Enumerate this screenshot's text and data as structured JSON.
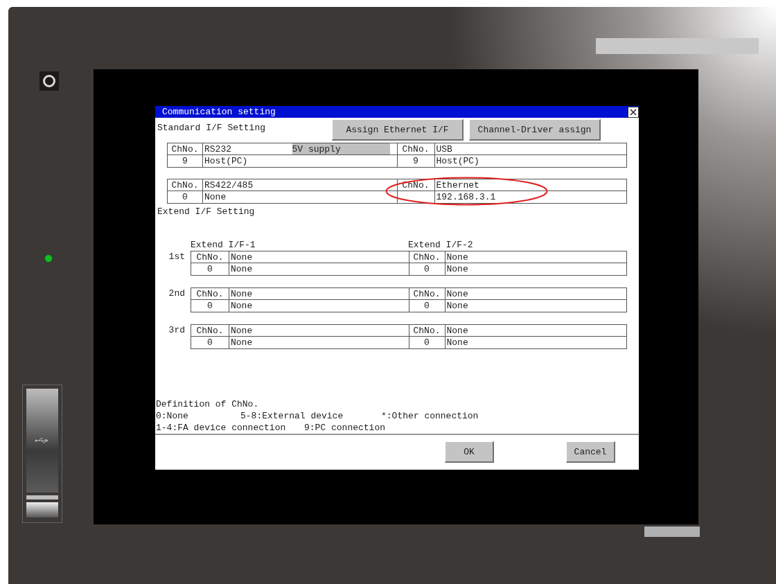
{
  "dialog": {
    "title": "Communication setting",
    "standard": {
      "label": "Standard I/F Setting",
      "buttons": [
        "Assign Ethernet I/F",
        "Channel-Driver assign"
      ],
      "rows": [
        {
          "ports": [
            {
              "ch_header": "ChNo.",
              "name": "RS232",
              "badge": "5V supply",
              "channel": "9",
              "value": "Host(PC)",
              "highlighted": false
            },
            {
              "ch_header": "ChNo.",
              "name": "USB",
              "channel": "9",
              "value": "Host(PC)",
              "highlighted": false
            }
          ]
        },
        {
          "ports": [
            {
              "ch_header": "ChNo.",
              "name": "RS422/485",
              "channel": "0",
              "value": "None",
              "highlighted": false
            },
            {
              "ch_header": "ChNo.",
              "name": "Ethernet",
              "value": "192.168.3.1",
              "highlighted": true
            }
          ]
        }
      ]
    },
    "extend": {
      "label": "Extend I/F Setting",
      "columns": [
        "Extend I/F-1",
        "Extend I/F-2"
      ],
      "rows": [
        {
          "label": "1st",
          "slots": [
            {
              "ch_header": "ChNo.",
              "name": "None",
              "channel": "0",
              "value": "None"
            },
            {
              "ch_header": "ChNo.",
              "name": "None",
              "channel": "0",
              "value": "None"
            }
          ]
        },
        {
          "label": "2nd",
          "slots": [
            {
              "ch_header": "ChNo.",
              "name": "None",
              "channel": "0",
              "value": "None"
            },
            {
              "ch_header": "ChNo.",
              "name": "None",
              "channel": "0",
              "value": "None"
            }
          ]
        },
        {
          "label": "3rd",
          "slots": [
            {
              "ch_header": "ChNo.",
              "name": "None",
              "channel": "0",
              "value": "None"
            },
            {
              "ch_header": "ChNo.",
              "name": "None",
              "channel": "0",
              "value": "None"
            }
          ]
        }
      ]
    },
    "definition": {
      "title": "Definition of ChNo.",
      "lines": [
        [
          "0:None",
          "5-8:External device",
          "*:Other connection"
        ],
        [
          "1-4:FA device connection",
          "9:PC connection"
        ]
      ]
    },
    "footer_buttons": [
      "OK",
      "Cancel"
    ]
  }
}
